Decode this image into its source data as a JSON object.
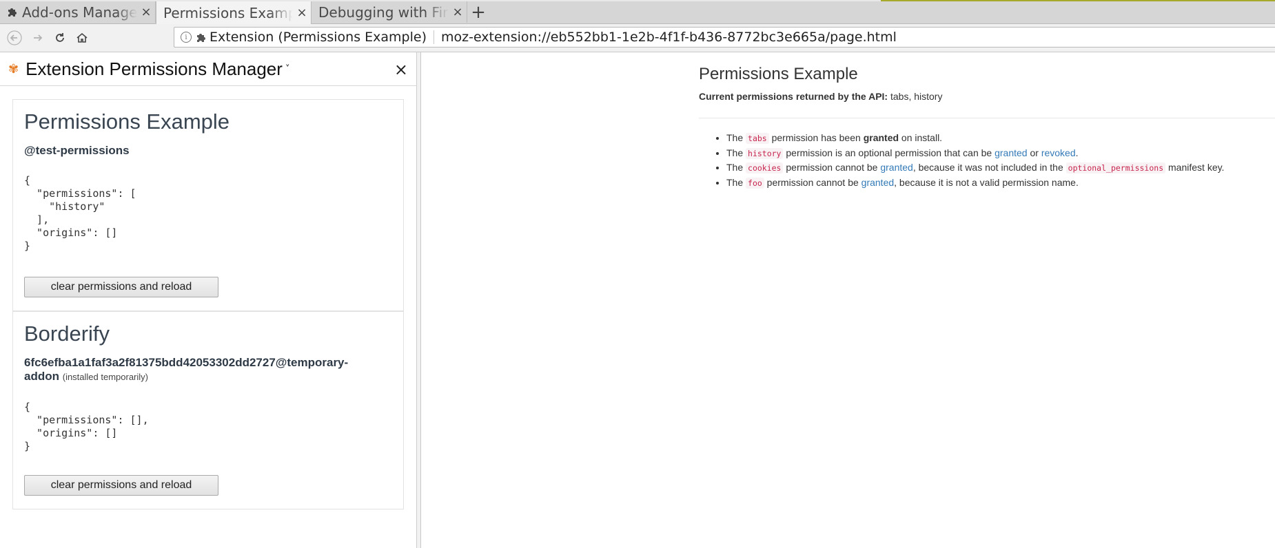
{
  "tabs": [
    {
      "label": "Add-ons Manager",
      "close": "×",
      "icon": "puzzle-icon"
    },
    {
      "label": "Permissions Example",
      "close": "×"
    },
    {
      "label": "Debugging with Firefox Developer Tools",
      "close": "×"
    }
  ],
  "new_tab": "+",
  "nav": {
    "back": "back-arrow-icon",
    "forward": "forward-arrow-icon",
    "reload": "reload-icon",
    "home": "home-icon"
  },
  "urlbar": {
    "identity_label": "Extension (Permissions Example)",
    "url": "moz-extension://eb552bb1-1e2b-4f1f-b436-8772bc3e665a/page.html"
  },
  "sidebar": {
    "title": "Extension Permissions Manager",
    "caret": "˅",
    "close": "×",
    "extensions": [
      {
        "name": "Permissions Example",
        "id": "@test-permissions",
        "temporary_note": "",
        "json": "{\n  \"permissions\": [\n    \"history\"\n  ],\n  \"origins\": []\n}",
        "button": "clear permissions and reload"
      },
      {
        "name": "Borderify",
        "id_line1": "6fc6efba1a1faf3a2f81375bdd42053302dd2727@temporary-",
        "id_line2": "addon",
        "temporary_note": "(installed temporarily)",
        "json": "{\n  \"permissions\": [],\n  \"origins\": []\n}",
        "button": "clear permissions and reload"
      }
    ]
  },
  "page": {
    "title": "Permissions Example",
    "api_label": "Current permissions returned by the API:",
    "api_value": "tabs, history",
    "items": [
      {
        "p1": "The ",
        "code": "tabs",
        "p2": " permission has been ",
        "strong": "granted",
        "p3": " on install."
      },
      {
        "p1": "The ",
        "code": "history",
        "p2": " permission is an optional permission that can be ",
        "link1": "granted",
        "p3": " or ",
        "link2": "revoked",
        "p4": "."
      },
      {
        "p1": "The ",
        "code": "cookies",
        "p2": " permission cannot be ",
        "link1": "granted",
        "p3": ", because it was not included in the ",
        "code2": "optional_permissions",
        "p4": " manifest key."
      },
      {
        "p1": "The ",
        "code": "foo",
        "p2": " permission cannot be ",
        "link1": "granted",
        "p3": ", because it is not a valid permission name."
      }
    ]
  },
  "colors": {
    "link": "#337ab7",
    "code_text": "#c7254e",
    "code_bg": "#f9f2f4",
    "sidebar_icon": "#e57b22"
  }
}
